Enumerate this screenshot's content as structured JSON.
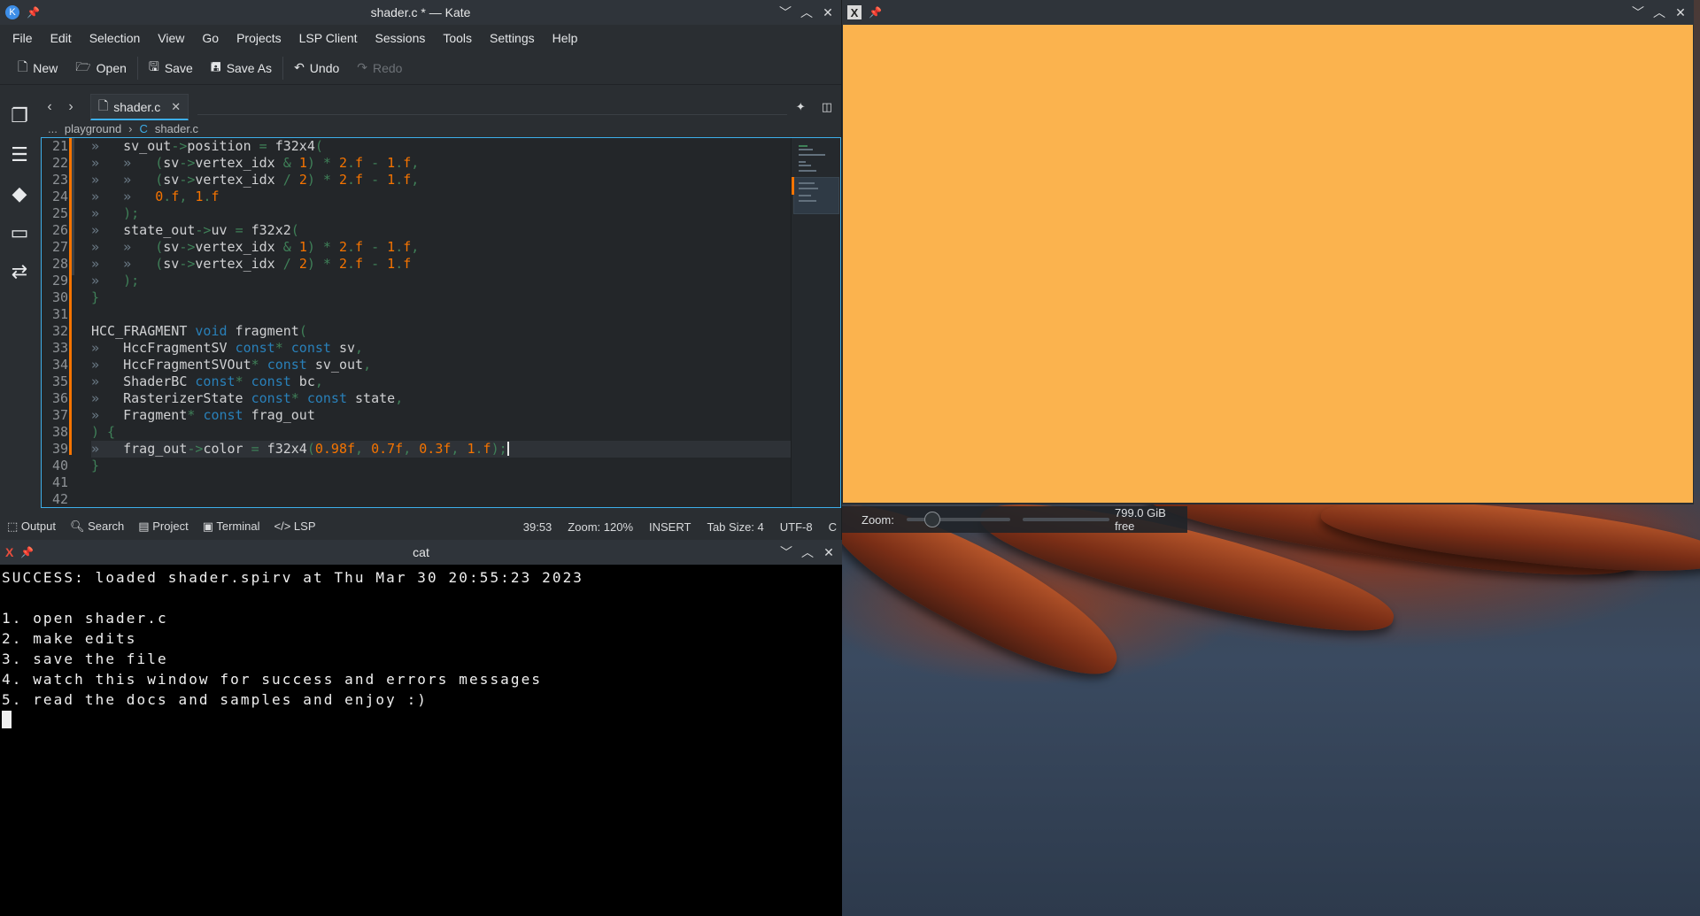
{
  "kate": {
    "title": "shader.c * — Kate",
    "menu": [
      "File",
      "Edit",
      "Selection",
      "View",
      "Go",
      "Projects",
      "LSP Client",
      "Sessions",
      "Tools",
      "Settings",
      "Help"
    ],
    "toolbar": {
      "new": "New",
      "open": "Open",
      "save": "Save",
      "save_as": "Save As",
      "undo": "Undo",
      "redo": "Redo"
    },
    "tab": {
      "label": "shader.c"
    },
    "breadcrumb": {
      "ellipsis": "...",
      "folder": "playground",
      "file": "shader.c"
    },
    "line_numbers": [
      "21",
      "22",
      "23",
      "24",
      "25",
      "26",
      "27",
      "28",
      "29",
      "30",
      "31",
      "32",
      "33",
      "34",
      "35",
      "36",
      "37",
      "38",
      "39",
      "40",
      "41",
      "42"
    ],
    "status": {
      "output": "Output",
      "search": "Search",
      "project": "Project",
      "terminal": "Terminal",
      "lsp": "LSP",
      "position": "39:53",
      "zoom": "Zoom: 120%",
      "mode": "INSERT",
      "tab_size": "Tab Size: 4",
      "encoding": "UTF-8",
      "language": "C"
    }
  },
  "terminal": {
    "title": "cat",
    "lines": [
      "SUCCESS: loaded shader.spirv at Thu Mar 30 20:55:23 2023",
      "",
      "1. open shader.c",
      "2. make edits",
      "3. save the file",
      "4. watch this window for success and errors messages",
      "5. read the docs and samples and enjoy :)"
    ]
  },
  "preview": {
    "canvas_color": "#fbb34e",
    "zoom_label": "Zoom:",
    "disk_free": "799.0 GiB free"
  },
  "colors": {
    "accent": "#3daee9",
    "keyword": "#2980b9",
    "number": "#f67400",
    "operator": "#3f8058"
  }
}
